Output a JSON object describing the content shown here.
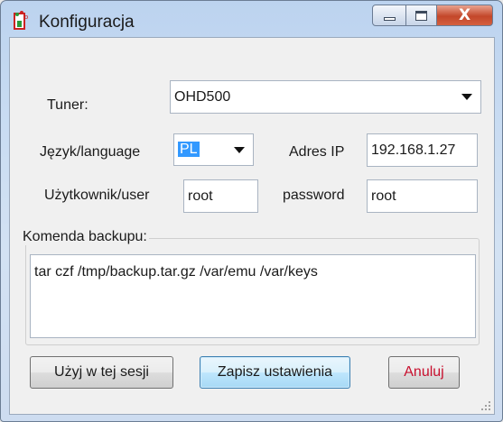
{
  "window": {
    "title": "Konfiguracja"
  },
  "form": {
    "tuner_label": "Tuner:",
    "tuner_value": "OHD500",
    "language_label": "Język/language",
    "language_value": "PL",
    "ip_label": "Adres IP",
    "ip_value": "192.168.1.27",
    "user_label": "Użytkownik/user",
    "user_value": "root",
    "password_label": "password",
    "password_value": "root"
  },
  "backup": {
    "group_label": "Komenda backupu:",
    "command": "tar czf /tmp/backup.tar.gz /var/emu /var/keys"
  },
  "buttons": {
    "use_session": "Użyj w tej sesji",
    "save": "Zapisz ustawienia",
    "cancel": "Anuluj"
  },
  "colors": {
    "accent_selection": "#3399ff",
    "cancel_text": "#c8102e",
    "close_button": "#c3472a"
  }
}
